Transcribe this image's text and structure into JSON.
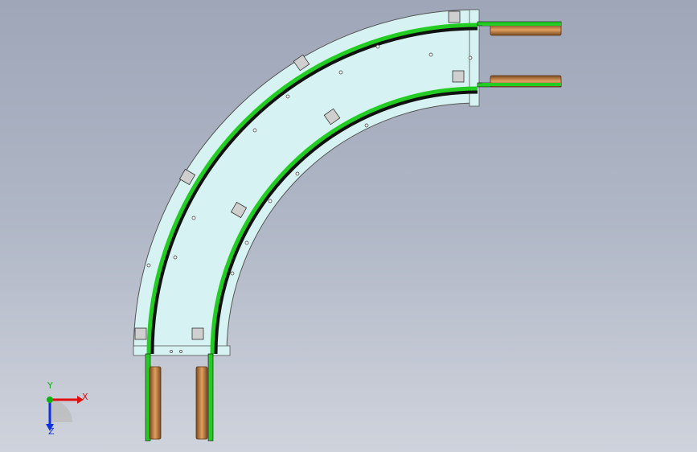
{
  "viewport": {
    "background_top": "#9ea6b8",
    "background_bottom": "#cfd3dc"
  },
  "model": {
    "description_visible": false,
    "plate_color": "#d6f2f2",
    "belt_color": "#22cc22",
    "rail_color": "#111111",
    "pulley_color": "#c07a3a"
  },
  "triad": {
    "x_label": "X",
    "y_label": "Y",
    "z_label": "Z",
    "x_color": "#e01010",
    "y_color": "#10b010",
    "z_color": "#1030e0"
  }
}
